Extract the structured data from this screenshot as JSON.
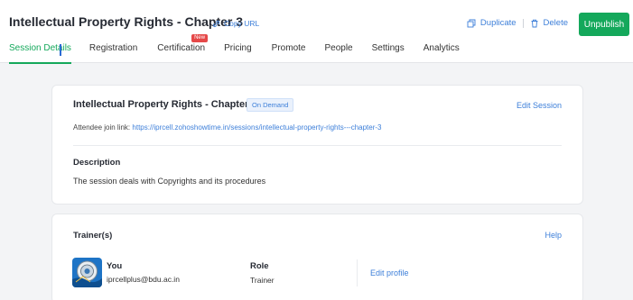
{
  "header": {
    "title": "Intellectual Property Rights - Chapter 3",
    "copy_url": "Copy URL",
    "duplicate": "Duplicate",
    "delete": "Delete",
    "unpublish": "Unpublish"
  },
  "tabs": [
    {
      "label": "Session Details",
      "active": true
    },
    {
      "label": "Registration"
    },
    {
      "label": "Certification",
      "badge": "New"
    },
    {
      "label": "Pricing"
    },
    {
      "label": "Promote"
    },
    {
      "label": "People"
    },
    {
      "label": "Settings"
    },
    {
      "label": "Analytics"
    }
  ],
  "session": {
    "title": "Intellectual Property Rights - Chapter 3",
    "type_badge": "On Demand",
    "edit_label": "Edit Session",
    "join_label": "Attendee join link:",
    "join_url": "https://iprcell.zohoshowtime.in/sessions/intellectual-property-rights---chapter-3",
    "description_label": "Description",
    "description_text": "The session deals with Copyrights and its procedures"
  },
  "trainers": {
    "title": "Trainer(s)",
    "help": "Help",
    "name": "You",
    "email": "iprcellplus@bdu.ac.in",
    "role_label": "Role",
    "role_value": "Trainer",
    "edit_profile": "Edit profile"
  },
  "colors": {
    "accent_green": "#14a85b",
    "link_blue": "#3d7fd9",
    "badge_red": "#e54848"
  }
}
